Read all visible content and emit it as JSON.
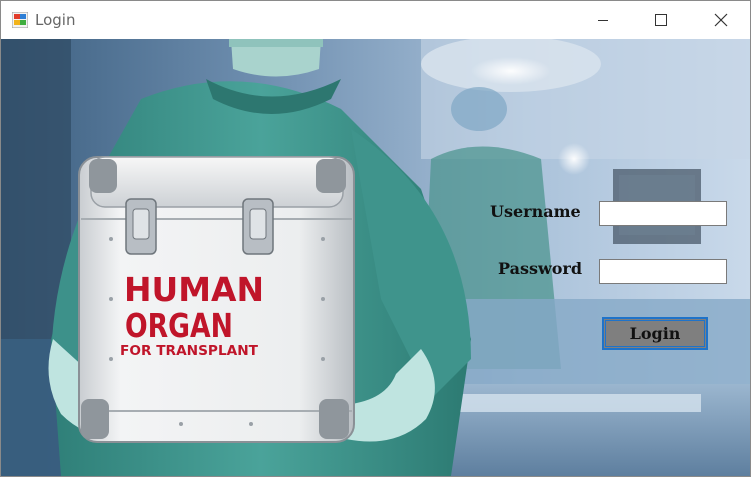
{
  "window": {
    "title": "Login",
    "controls": {
      "minimize_icon": "minimize-icon",
      "maximize_icon": "maximize-icon",
      "close_icon": "close-icon"
    }
  },
  "background": {
    "case_text_line1": "HUMAN",
    "case_text_line2": "ORGAN",
    "case_text_line3": "FOR TRANSPLANT"
  },
  "form": {
    "username_label": "Username",
    "username_value": "",
    "password_label": "Password",
    "password_value": "",
    "login_label": "Login"
  },
  "colors": {
    "login_button_bg": "#7f7f7f",
    "login_button_border": "#1f73c9",
    "scrubs": "#4aa39a",
    "case_text": "#c0152a"
  }
}
